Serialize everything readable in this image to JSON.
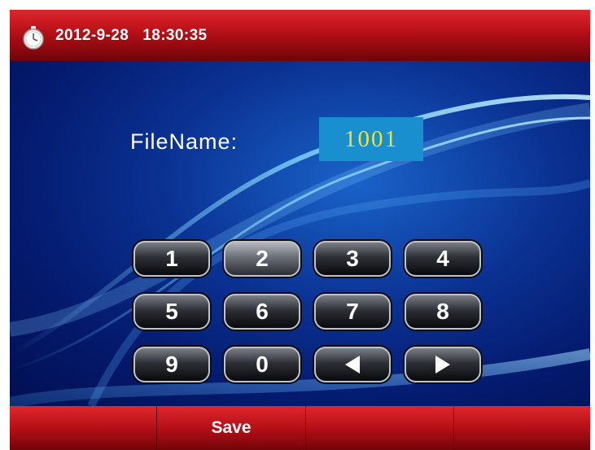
{
  "header": {
    "datetime": "2012-9-28   18:30:35"
  },
  "form": {
    "filename_label": "FileName:",
    "filename_value": "1001"
  },
  "keypad": {
    "keys": [
      "1",
      "2",
      "3",
      "4",
      "5",
      "6",
      "7",
      "8",
      "9",
      "0"
    ],
    "icons": [
      "left-arrow-icon",
      "right-arrow-icon"
    ]
  },
  "footer": {
    "buttons": [
      "",
      "Save",
      "",
      ""
    ]
  },
  "colors": {
    "bar_red": "#c8141c",
    "field_blue": "#1a8fd0",
    "field_text": "#f6e12a"
  }
}
